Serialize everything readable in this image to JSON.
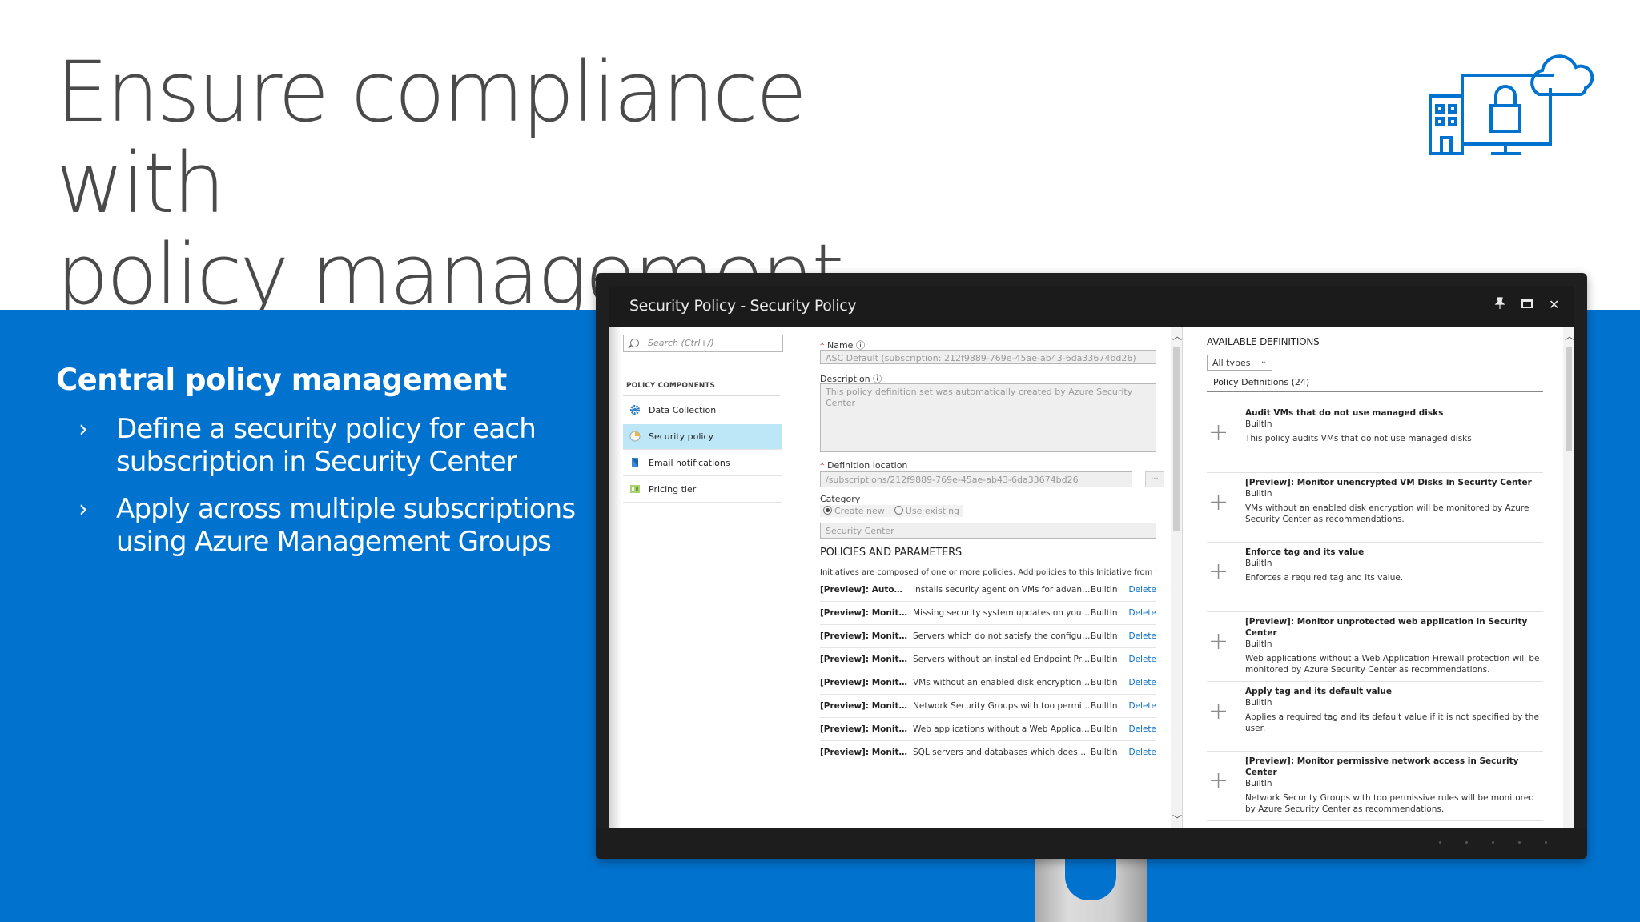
{
  "slide": {
    "title_line1": "Ensure compliance with",
    "title_line2": "policy management",
    "heading": "Central policy management",
    "bullets": [
      {
        "line1": "Define a security policy for each",
        "line2": "subscription in Security Center"
      },
      {
        "line1": "Apply across multiple subscriptions",
        "line2": "using Azure Management Groups"
      }
    ],
    "chevron": "›"
  },
  "colors": {
    "brand_blue": "#0173cf",
    "link": "#0b6fc4",
    "active_nav": "#bde6f7"
  },
  "window": {
    "title": "Security Policy - Security Policy",
    "pin_icon": "📌",
    "maximize_icon": "▭",
    "close_icon": "✕"
  },
  "nav": {
    "search_placeholder": "Search (Ctrl+/)",
    "section": "POLICY COMPONENTS",
    "items": [
      {
        "label": "Data Collection",
        "icon": "gear-icon"
      },
      {
        "label": "Security policy",
        "icon": "policy-icon",
        "active": true
      },
      {
        "label": "Email notifications",
        "icon": "email-icon"
      },
      {
        "label": "Pricing tier",
        "icon": "pricing-icon"
      }
    ]
  },
  "form": {
    "name_label": "Name",
    "name_value": "ASC Default (subscription: 212f9889-769e-45ae-ab43-6da33674bd26)",
    "description_label": "Description",
    "description_value": "This policy definition set was automatically created by Azure Security Center",
    "location_label": "Definition location",
    "location_value": "/subscriptions/212f9889-769e-45ae-ab43-6da33674bd26",
    "location_btn": "...",
    "category_label": "Category",
    "radio_create": "Create new",
    "radio_existing": "Use existing",
    "category_value": "Security Center",
    "policies_heading": "POLICIES AND PARAMETERS",
    "policies_note": "Initiatives are composed of one or more policies. Add policies to this Initiative from the",
    "policies": [
      {
        "name": "[Preview]: Automat...",
        "desc": "Installs security agent on VMs for advanced...",
        "type": "BuiltIn",
        "action": "Delete"
      },
      {
        "name": "[Preview]: Monitor...",
        "desc": "Missing security system updates on your ser...",
        "type": "BuiltIn",
        "action": "Delete"
      },
      {
        "name": "[Preview]: Monitor...",
        "desc": "Servers which do not satisfy the configured...",
        "type": "BuiltIn",
        "action": "Delete"
      },
      {
        "name": "[Preview]: Monitor...",
        "desc": "Servers without an installed Endpoint Protec...",
        "type": "BuiltIn",
        "action": "Delete"
      },
      {
        "name": "[Preview]: Monitor...",
        "desc": "VMs without an enabled disk encryption will...",
        "type": "BuiltIn",
        "action": "Delete"
      },
      {
        "name": "[Preview]: Monitor...",
        "desc": "Network Security Groups with too permissiv...",
        "type": "BuiltIn",
        "action": "Delete"
      },
      {
        "name": "[Preview]: Monitor...",
        "desc": "Web applications without a Web Applicatio...",
        "type": "BuiltIn",
        "action": "Delete"
      },
      {
        "name": "[Preview]: Monitor...",
        "desc": "SQL servers and databases which doesn't ha...",
        "type": "BuiltIn",
        "action": "Delete"
      }
    ]
  },
  "available": {
    "title": "AVAILABLE DEFINITIONS",
    "filter": "All types",
    "tab": "Policy Definitions (24)",
    "definitions": [
      {
        "title": "Audit VMs that do not use managed disks",
        "type": "BuiltIn",
        "desc": "This policy audits VMs that do not use managed disks"
      },
      {
        "title": "[Preview]: Monitor unencrypted VM Disks in Security Center",
        "type": "BuiltIn",
        "desc": "VMs without an enabled disk encryption will be monitored by Azure Security Center as recommendations."
      },
      {
        "title": "Enforce tag and its value",
        "type": "BuiltIn",
        "desc": "Enforces a required tag and its value."
      },
      {
        "title": "[Preview]: Monitor unprotected web application in Security Center",
        "type": "BuiltIn",
        "desc": "Web applications without a Web Application Firewall protection will be monitored by Azure Security Center as recommendations."
      },
      {
        "title": "Apply tag and its default value",
        "type": "BuiltIn",
        "desc": "Applies a required tag and its default value if it is not specified by the user."
      },
      {
        "title": "[Preview]: Monitor permissive network access in Security Center",
        "type": "BuiltIn",
        "desc": "Network Security Groups with too permissive rules will be monitored by Azure Security Center as recommendations."
      }
    ]
  }
}
